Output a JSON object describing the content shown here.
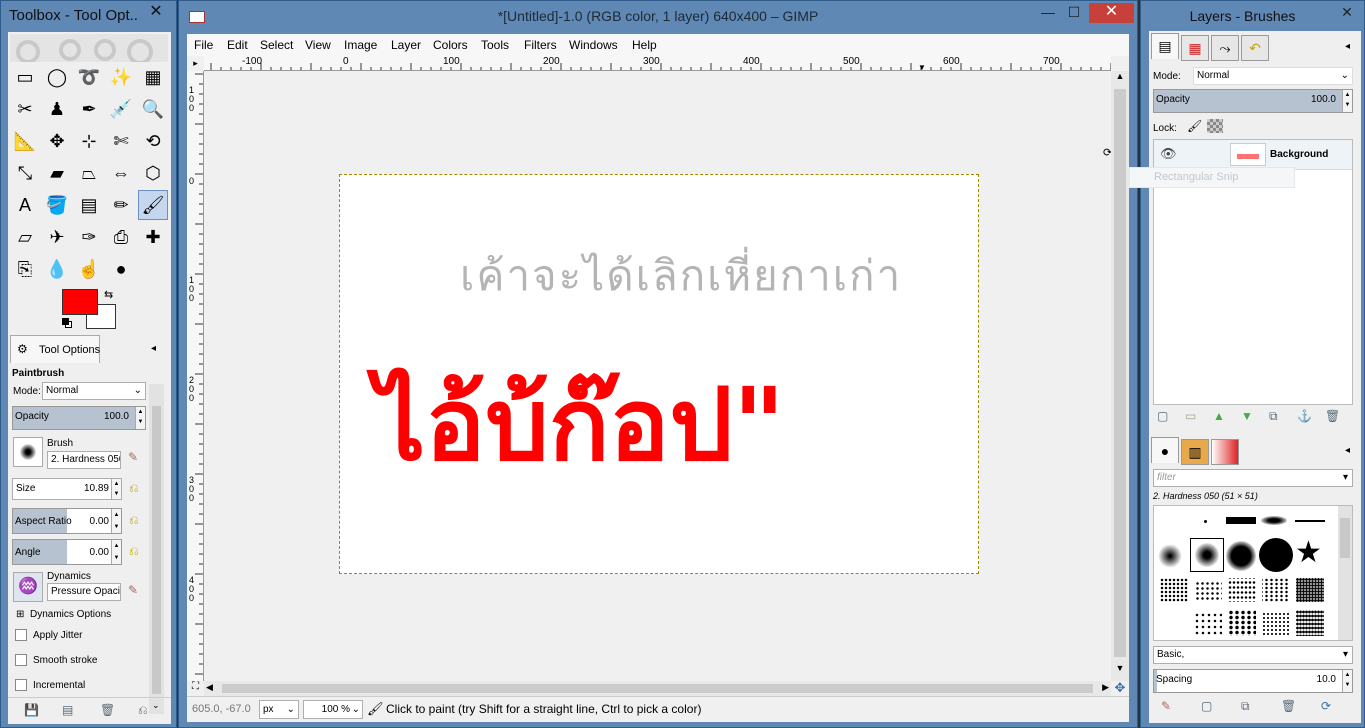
{
  "toolbox": {
    "title": "Toolbox - Tool Opt...",
    "close": "✕",
    "tools": [
      {
        "name": "rect-select-icon",
        "glyph": "▭"
      },
      {
        "name": "ellipse-select-icon",
        "glyph": "◯"
      },
      {
        "name": "free-select-icon",
        "glyph": "➰"
      },
      {
        "name": "fuzzy-select-icon",
        "glyph": "✨"
      },
      {
        "name": "select-by-color-icon",
        "glyph": "▦"
      },
      {
        "name": "scissors-select-icon",
        "glyph": "✂"
      },
      {
        "name": "foreground-select-icon",
        "glyph": "♟"
      },
      {
        "name": "paths-icon",
        "glyph": "✒"
      },
      {
        "name": "color-picker-icon",
        "glyph": "💉"
      },
      {
        "name": "zoom-icon",
        "glyph": "🔍"
      },
      {
        "name": "measure-icon",
        "glyph": "📐"
      },
      {
        "name": "move-icon",
        "glyph": "✥"
      },
      {
        "name": "align-icon",
        "glyph": "⊹"
      },
      {
        "name": "crop-icon",
        "glyph": "✄"
      },
      {
        "name": "rotate-icon",
        "glyph": "⟲"
      },
      {
        "name": "scale-icon",
        "glyph": "⤡"
      },
      {
        "name": "shear-icon",
        "glyph": "▰"
      },
      {
        "name": "perspective-icon",
        "glyph": "⏢"
      },
      {
        "name": "flip-icon",
        "glyph": "⇔"
      },
      {
        "name": "cage-transform-icon",
        "glyph": "⬡"
      },
      {
        "name": "text-icon",
        "glyph": "A"
      },
      {
        "name": "bucket-fill-icon",
        "glyph": "🪣"
      },
      {
        "name": "blend-icon",
        "glyph": "▤"
      },
      {
        "name": "pencil-icon",
        "glyph": "✏"
      },
      {
        "name": "paintbrush-icon",
        "glyph": "🖌"
      },
      {
        "name": "eraser-icon",
        "glyph": "▱"
      },
      {
        "name": "airbrush-icon",
        "glyph": "✈"
      },
      {
        "name": "ink-icon",
        "glyph": "✑"
      },
      {
        "name": "clone-icon",
        "glyph": "⎙"
      },
      {
        "name": "heal-icon",
        "glyph": "✚"
      },
      {
        "name": "perspective-clone-icon",
        "glyph": "⎘"
      },
      {
        "name": "blur-icon",
        "glyph": "💧"
      },
      {
        "name": "smudge-icon",
        "glyph": "☝"
      },
      {
        "name": "dodge-burn-icon",
        "glyph": "●"
      }
    ],
    "fg_color": "#ff0000",
    "bg_color": "#ffffff",
    "tab_label": "Tool Options",
    "tool_name": "Paintbrush",
    "mode_label": "Mode:",
    "mode_value": "Normal",
    "opacity_label": "Opacity",
    "opacity_value": "100.0",
    "opacity_fraction": 1.0,
    "brush_label": "Brush",
    "brush_value": "2. Hardness 050",
    "size_label": "Size",
    "size_value": "10.89",
    "aspect_label": "Aspect Ratio",
    "aspect_value": "0.00",
    "aspect_fraction": 0.5,
    "angle_label": "Angle",
    "angle_value": "0.00",
    "angle_fraction": 0.5,
    "dynamics_label": "Dynamics",
    "dynamics_value": "Pressure Opacit",
    "dynamics_options": "Dynamics Options",
    "apply_jitter": "Apply Jitter",
    "smooth_stroke": "Smooth stroke",
    "incremental": "Incremental"
  },
  "imagewin": {
    "title": "*[Untitled]-1.0 (RGB color, 1 layer) 640x400 – GIMP",
    "minimize": "—",
    "maximize": "☐",
    "close": "✕",
    "menu": [
      "File",
      "Edit",
      "Select",
      "View",
      "Image",
      "Layer",
      "Colors",
      "Tools",
      "Filters",
      "Windows",
      "Help"
    ],
    "hruler": [
      "-100",
      "0",
      "100",
      "200",
      "300",
      "400",
      "500",
      "600",
      "700"
    ],
    "vruler": [
      "1 0 0",
      "0",
      "1 0 0",
      "2 0 0",
      "3 0 0",
      "4 0 0"
    ],
    "gray_text": "เค้าจะได้เลิกเหี่ยกาเก่า",
    "red_text": "ไอ้บ้ก๊อป\"",
    "coords": "605.0, -67.0",
    "unit": "px",
    "zoom": "100 %",
    "status": "Click to paint (try Shift for a straight line, Ctrl to pick a color)"
  },
  "layers": {
    "title": "Layers - Brushes",
    "close": "✕",
    "mode_label": "Mode:",
    "mode_value": "Normal",
    "opacity_label": "Opacity",
    "opacity_value": "100.0",
    "opacity_fraction": 1.0,
    "lock_label": "Lock:",
    "layer_name": "Background",
    "tooltip": "Rectangular Snip",
    "filter_placeholder": "filter",
    "brush_name": "2. Hardness 050 (51 × 51)",
    "tag_value": "Basic,",
    "spacing_label": "Spacing",
    "spacing_value": "10.0"
  }
}
